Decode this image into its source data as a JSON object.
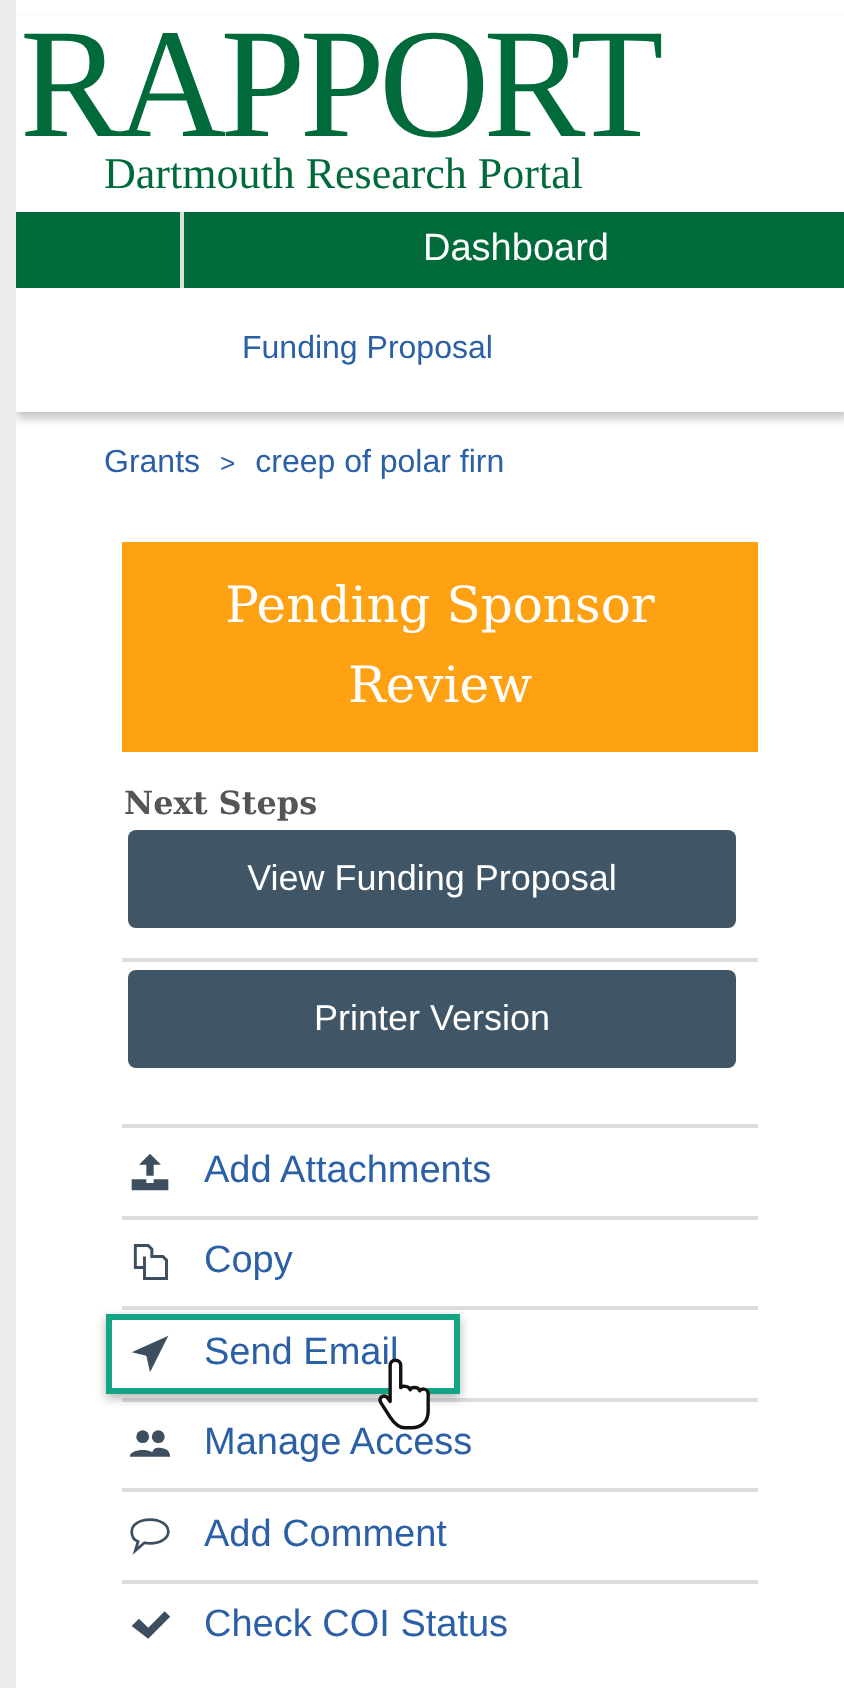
{
  "logo": {
    "title": "RAPPORT",
    "subtitle": "Dartmouth Research Portal"
  },
  "nav": {
    "items": [
      {
        "label": "Dashboard"
      }
    ]
  },
  "subnav": {
    "label": "Funding Proposal"
  },
  "breadcrumb": [
    {
      "label": "Grants"
    },
    {
      "label": ">"
    },
    {
      "label": "creep of polar firn"
    }
  ],
  "status": {
    "label": "Pending Sponsor Review"
  },
  "next_steps": {
    "title": "Next Steps",
    "buttons": [
      "View Funding Proposal",
      "Printer Version"
    ]
  },
  "actions": [
    {
      "label": "Add Attachments",
      "highlighted": false
    },
    {
      "label": "Copy",
      "highlighted": false
    },
    {
      "label": "Send Email",
      "highlighted": true
    },
    {
      "label": "Manage Access",
      "highlighted": false
    },
    {
      "label": "Add Comment",
      "highlighted": false
    },
    {
      "label": "Check COI Status",
      "highlighted": false
    }
  ]
}
